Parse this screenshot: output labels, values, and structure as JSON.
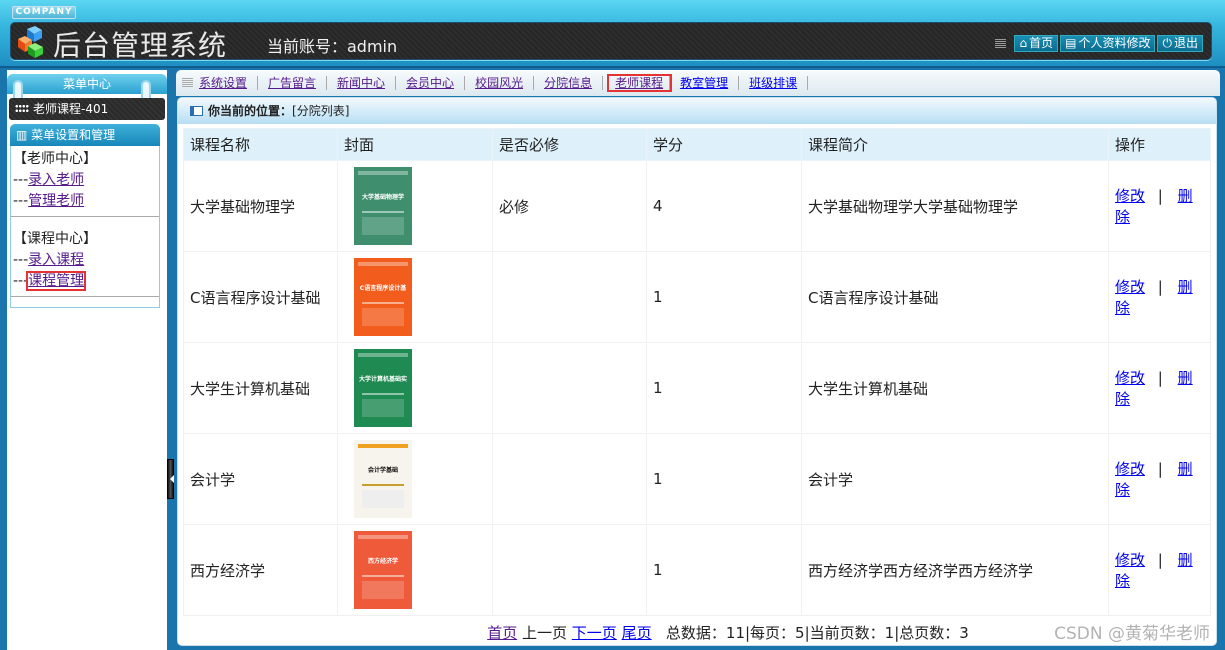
{
  "header": {
    "company": "COMPANY",
    "title": "后台管理系统",
    "account_label": "当前账号：admin",
    "buttons": [
      {
        "icon": "home-icon",
        "label": "首页"
      },
      {
        "icon": "document-icon",
        "label": "个人资料修改"
      },
      {
        "icon": "power-icon",
        "label": "退出"
      }
    ]
  },
  "sidebar": {
    "menu_title": "菜单中心",
    "current_item": "老师课程-401",
    "section_title": "菜单设置和管理",
    "groups": [
      {
        "title": "【老师中心】",
        "links": [
          "录入老师",
          "管理老师"
        ]
      },
      {
        "title": "【课程中心】",
        "links": [
          "录入课程",
          "课程管理"
        ]
      }
    ],
    "prefix": "---"
  },
  "nav": {
    "items": [
      "系统设置",
      "广告留言",
      "新闻中心",
      "会员中心",
      "校园风光",
      "分院信息",
      "老师课程",
      "教室管理",
      "班级排课"
    ],
    "active": "老师课程"
  },
  "breadcrumb": {
    "label": "你当前的位置：",
    "value": "[分院列表]"
  },
  "table": {
    "headers": [
      "课程名称",
      "封面",
      "是否必修",
      "学分",
      "课程简介",
      "操作"
    ],
    "rows": [
      {
        "name": "大学基础物理学",
        "cover": "大学基础物理学",
        "required": "必修",
        "credit": "4",
        "intro": "大学基础物理学大学基础物理学",
        "cover_color": "#3f8f6e"
      },
      {
        "name": "C语言程序设计基础",
        "cover": "C语言程序设计基础",
        "required": "",
        "credit": "1",
        "intro": "C语言程序设计基础",
        "cover_color": "#f25c1c"
      },
      {
        "name": "大学生计算机基础",
        "cover": "大学计算机基础实验教程",
        "required": "",
        "credit": "1",
        "intro": "大学生计算机基础",
        "cover_color": "#1f8a52"
      },
      {
        "name": "会计学",
        "cover": "会计学基础",
        "required": "",
        "credit": "1",
        "intro": "会计学",
        "cover_color": "#f7f4ee"
      },
      {
        "name": "西方经济学",
        "cover": "西方经济学",
        "required": "",
        "credit": "1",
        "intro": "西方经济学西方经济学西方经济学",
        "cover_color": "#ee5a3a"
      }
    ],
    "edit_label": "修改",
    "delete_label": "删除",
    "separator": "|"
  },
  "pager": {
    "first": "首页",
    "prev": "上一页",
    "next": "下一页",
    "last": "尾页",
    "summary": "总数据：11|每页：5|当前页数：1|总页数：3"
  },
  "watermark": "CSDN @黄菊华老师"
}
